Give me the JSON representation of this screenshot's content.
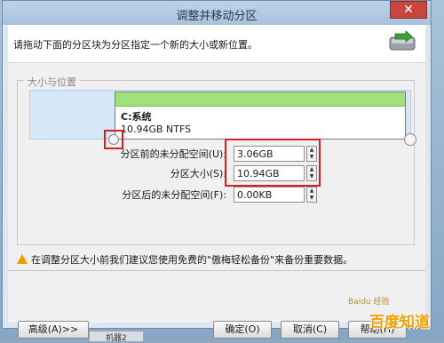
{
  "window": {
    "title": "调整并移动分区",
    "close_label": "✕"
  },
  "header": {
    "instruction": "请拖动下面的分区块为分区指定一个新的大小或新位置。",
    "icon": "disk-move-icon"
  },
  "group": {
    "label": "大小与位置"
  },
  "partition": {
    "name": "C:系统",
    "size": "10.94GB NTFS"
  },
  "fields": [
    {
      "label": "分区前的未分配空间(U):",
      "value": "3.06GB"
    },
    {
      "label": "分区大小(S):",
      "value": "10.94GB"
    },
    {
      "label": "分区后的未分配空间(F):",
      "value": "0.00KB"
    }
  ],
  "warning": {
    "text": "在调整分区大小前我们建议您使用免费的\"傲梅轻松备份\"来备份重要数据。"
  },
  "buttons": {
    "advanced": "高级(A)>>",
    "ok": "确定(O)",
    "cancel": "取消(C)",
    "help": "帮助(H)"
  },
  "taskbar": {
    "item": "机器2"
  },
  "watermark": {
    "url": "Baidu 经验",
    "logo": "百度知道"
  },
  "colors": {
    "accent_red": "#d42020",
    "partition_bar": "#9fe07a",
    "window_bg": "#f0f0f0"
  }
}
